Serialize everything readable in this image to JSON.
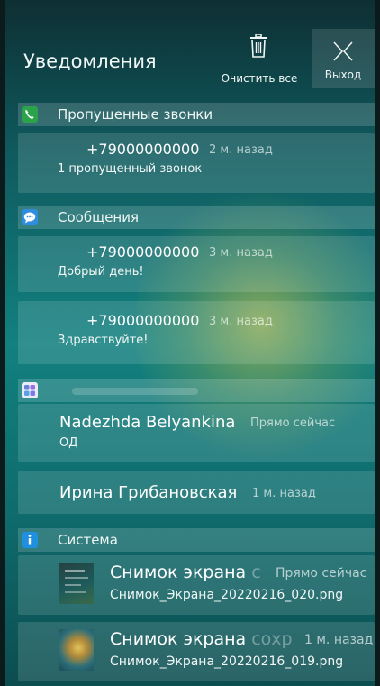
{
  "header": {
    "title": "Уведомления",
    "clear_label": "Очистить все",
    "exit_label": "Выход"
  },
  "sections": {
    "missed_calls": {
      "label": "Пропущенные звонки",
      "icon": "phone-icon",
      "color": "#2aa34a",
      "item": {
        "title": "+79000000000",
        "time": "2 м. назад",
        "body": "1 пропущенный звонок"
      }
    },
    "messages": {
      "label": "Сообщения",
      "icon": "chat-bubble-icon",
      "color": "#2f8de0",
      "items": [
        {
          "title": "+79000000000",
          "time": "3 м. назад",
          "body": "Добрый день!"
        },
        {
          "title": "+79000000000",
          "time": "3 м. назад",
          "body": "Здравствуйте!"
        }
      ]
    },
    "app": {
      "label": "",
      "icon": "app-grid-icon",
      "color": "#6b7fe0",
      "items": [
        {
          "title": "Nadezhda Belyankina",
          "time": "Прямо сейчас",
          "body": "ОД"
        },
        {
          "title": "Ирина Грибановская",
          "time": "1 м. назад",
          "body": ""
        }
      ]
    },
    "system": {
      "label": "Система",
      "icon": "info-icon",
      "color": "#1f8fe0",
      "items": [
        {
          "title_main": "Снимок экрана ",
          "title_fade": "с",
          "time": "Прямо сейчас",
          "body": "Снимок_Экрана_20220216_020.png"
        },
        {
          "title_main": "Снимок экрана ",
          "title_fade": "сохр",
          "time": "1 м. назад",
          "body": "Снимок_Экрана_20220216_019.png"
        }
      ]
    }
  }
}
